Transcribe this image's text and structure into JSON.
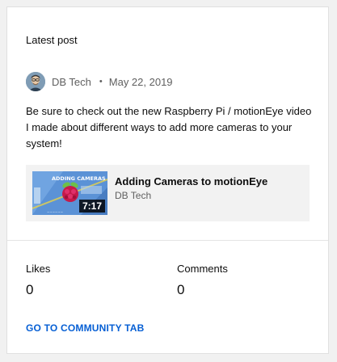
{
  "card": {
    "title": "Latest post"
  },
  "post": {
    "author": "DB Tech",
    "separator": "•",
    "date": "May 22, 2019",
    "text": "Be sure to check out the new Raspberry Pi / motionEye video I made about different ways to add more cameras to your system!"
  },
  "video": {
    "title": "Adding Cameras to motionEye",
    "channel": "DB Tech",
    "duration": "7:17",
    "thumbnail_text": "ADDING CAMERAS"
  },
  "stats": {
    "likes_label": "Likes",
    "likes_value": "0",
    "comments_label": "Comments",
    "comments_value": "0"
  },
  "link": {
    "label": "GO TO COMMUNITY TAB"
  },
  "colors": {
    "link": "#065fd4",
    "text_primary": "#0d0d0d",
    "text_secondary": "#606060",
    "thumbnail_bg": "#5a8fd4"
  }
}
